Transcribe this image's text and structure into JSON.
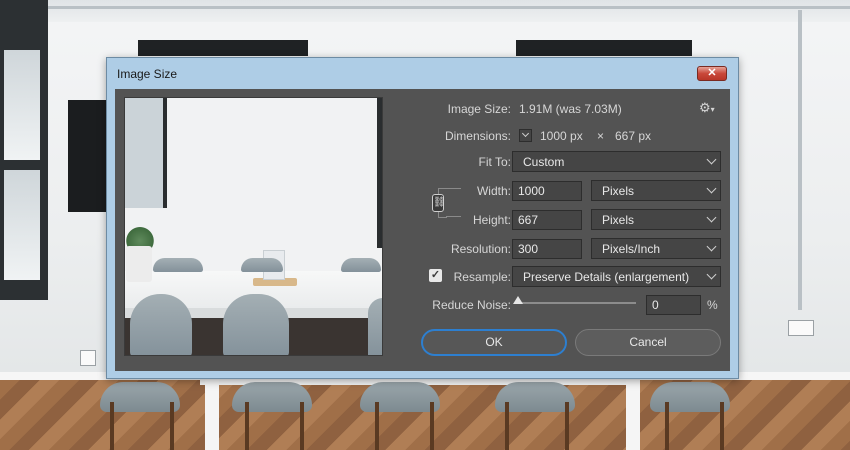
{
  "dialog": {
    "title": "Image Size",
    "close_label": "✕",
    "image_size": {
      "label": "Image Size:",
      "value": "1.91M (was 7.03M)"
    },
    "dimensions": {
      "label": "Dimensions:",
      "width": "1000 px",
      "times": "×",
      "height": "667 px"
    },
    "fit_to": {
      "label": "Fit To:",
      "value": "Custom"
    },
    "width": {
      "label": "Width:",
      "value": "1000",
      "unit": "Pixels"
    },
    "height": {
      "label": "Height:",
      "value": "667",
      "unit": "Pixels"
    },
    "resolution": {
      "label": "Resolution:",
      "value": "300",
      "unit": "Pixels/Inch"
    },
    "resample": {
      "label": "Resample:",
      "checked": true,
      "value": "Preserve Details (enlargement)"
    },
    "reduce_noise": {
      "label": "Reduce Noise:",
      "value": "0",
      "unit": "%",
      "slider_fraction": 0
    },
    "ok_label": "OK",
    "cancel_label": "Cancel"
  },
  "icons": {
    "gear": "gear-icon",
    "link": "link-icon",
    "check": "checkbox-checked",
    "chevron": "chevron-down-icon"
  },
  "colors": {
    "dialog_bg": "#535353",
    "frame": "#aecde6",
    "accent": "#2d7fd0",
    "close": "#c9483a"
  }
}
